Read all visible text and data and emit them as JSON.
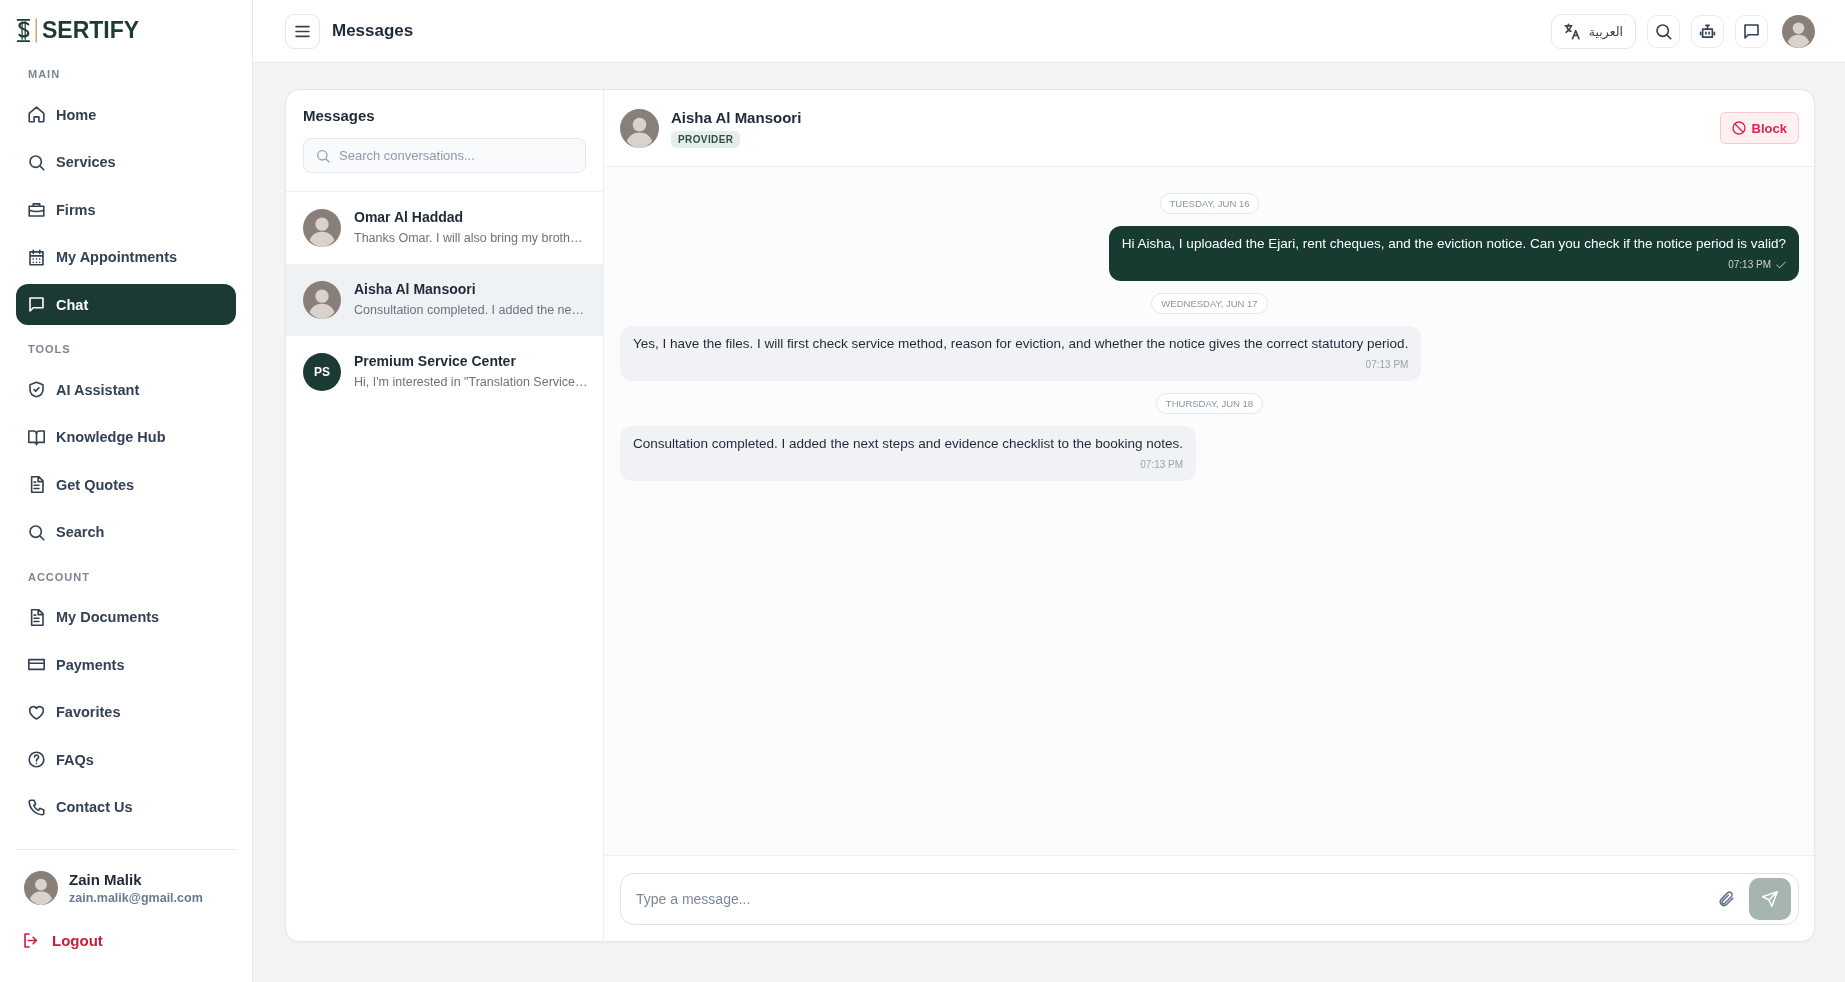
{
  "sidebar": {
    "logo": {
      "wordmark": "SERTIFY"
    },
    "sections": [
      {
        "heading": "MAIN",
        "items": [
          {
            "label": "Home",
            "selected": false
          },
          {
            "label": "Services",
            "selected": false
          },
          {
            "label": "Firms",
            "selected": false
          },
          {
            "label": "My Appointments",
            "selected": false
          },
          {
            "label": "Chat",
            "selected": true
          }
        ]
      },
      {
        "heading": "TOOLS",
        "items": [
          {
            "label": "AI Assistant",
            "selected": false
          },
          {
            "label": "Knowledge Hub",
            "selected": false
          },
          {
            "label": "Get Quotes",
            "selected": false
          },
          {
            "label": "Search",
            "selected": false
          }
        ]
      },
      {
        "heading": "ACCOUNT",
        "items": [
          {
            "label": "My Documents",
            "selected": false
          },
          {
            "label": "Payments",
            "selected": false
          },
          {
            "label": "Favorites",
            "selected": false
          },
          {
            "label": "FAQs",
            "selected": false
          },
          {
            "label": "Contact Us",
            "selected": false
          }
        ]
      }
    ],
    "user": {
      "name": "Zain Malik",
      "email": "zain.malik@gmail.com"
    },
    "logout": "Logout"
  },
  "topbar": {
    "title": "Messages",
    "language_button": "العربية"
  },
  "conversations": {
    "title": "Messages",
    "search": {
      "placeholder": "Search conversations..."
    },
    "items": [
      {
        "name": "Omar Al Haddad",
        "preview": "Thanks Omar. I will also bring my broth…",
        "avatar": {
          "kind": "photo"
        },
        "selected": false
      },
      {
        "name": "Aisha Al Mansoori",
        "preview": "Consultation completed. I added the ne…",
        "avatar": {
          "kind": "photo"
        },
        "selected": true
      },
      {
        "name": "Premium Service Center",
        "preview": "Hi, I'm interested in \"Translation Service…",
        "avatar": {
          "kind": "initials",
          "initials": "PS"
        },
        "selected": false
      }
    ]
  },
  "chat": {
    "contact": {
      "name": "Aisha Al Mansoori",
      "role": "PROVIDER"
    },
    "block_button": "Block",
    "messages": [
      {
        "kind": "date",
        "label": "TUESDAY, JUN 16"
      },
      {
        "kind": "sent",
        "text": "Hi Aisha, I uploaded the Ejari, rent cheques, and the eviction notice. Can you check if the notice period is valid?",
        "time": "07:13 PM",
        "read": true
      },
      {
        "kind": "date",
        "label": "WEDNESDAY, JUN 17"
      },
      {
        "kind": "received",
        "text": "Yes, I have the files. I will first check service method, reason for eviction, and whether the notice gives the correct statutory period.",
        "time": "07:13 PM"
      },
      {
        "kind": "date",
        "label": "THURSDAY, JUN 18"
      },
      {
        "kind": "received",
        "text": "Consultation completed. I added the next steps and evidence checklist to the booking notes.",
        "time": "07:13 PM"
      }
    ],
    "composer": {
      "placeholder": "Type a message...",
      "send_button": {
        "disabled": true
      }
    }
  }
}
